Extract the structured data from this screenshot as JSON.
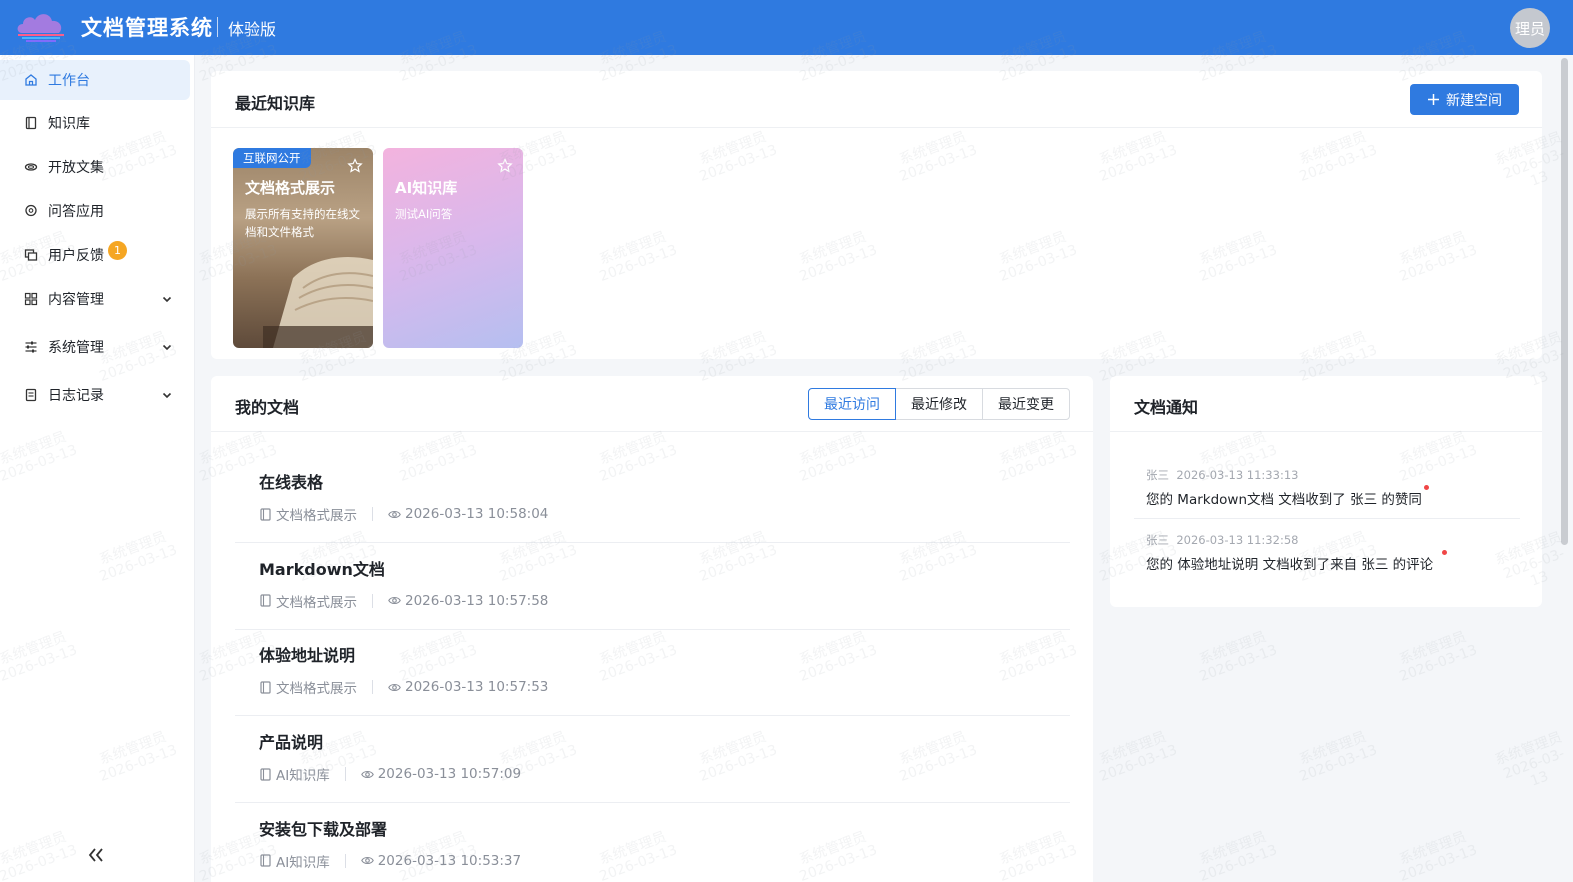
{
  "header": {
    "title": "文档管理系统",
    "edition": "体验版",
    "avatar_text": "理员"
  },
  "sidebar": {
    "items": [
      {
        "label": "工作台",
        "icon": "home-icon"
      },
      {
        "label": "知识库",
        "icon": "book-icon"
      },
      {
        "label": "开放文集",
        "icon": "share-icon"
      },
      {
        "label": "问答应用",
        "icon": "chat-icon"
      },
      {
        "label": "用户反馈",
        "icon": "feedback-icon",
        "badge": "1"
      },
      {
        "label": "内容管理",
        "icon": "grid-icon"
      },
      {
        "label": "系统管理",
        "icon": "sliders-icon"
      },
      {
        "label": "日志记录",
        "icon": "log-icon"
      }
    ]
  },
  "recent_kb": {
    "title": "最近知识库",
    "new_button": "新建空间",
    "cards": [
      {
        "tag": "互联网公开",
        "name": "文档格式展示",
        "desc": "展示所有支持的在线文档和文件格式"
      },
      {
        "name": "AI知识库",
        "desc": "测试AI问答"
      }
    ]
  },
  "my_docs": {
    "title": "我的文档",
    "tabs": [
      "最近访问",
      "最近修改",
      "最近变更"
    ],
    "active_tab": "最近访问",
    "items": [
      {
        "title": "在线表格",
        "kb": "文档格式展示",
        "time": "2026-03-13 10:58:04"
      },
      {
        "title": "Markdown文档",
        "kb": "文档格式展示",
        "time": "2026-03-13 10:57:58"
      },
      {
        "title": "体验地址说明",
        "kb": "文档格式展示",
        "time": "2026-03-13 10:57:53"
      },
      {
        "title": "产品说明",
        "kb": "AI知识库",
        "time": "2026-03-13 10:57:09"
      },
      {
        "title": "安装包下载及部署",
        "kb": "AI知识库",
        "time": "2026-03-13 10:53:37"
      }
    ]
  },
  "notifications": {
    "title": "文档通知",
    "items": [
      {
        "user": "张三",
        "time": "2026-03-13 11:33:13",
        "text": "您的 Markdown文档 文档收到了 张三 的赞同"
      },
      {
        "user": "张三",
        "time": "2026-03-13 11:32:58",
        "text": "您的 体验地址说明 文档收到了来自 张三 的评论"
      }
    ]
  },
  "watermark": {
    "line1": "系统管理员",
    "line2": "2026-03-13"
  },
  "colors": {
    "primary": "#2f7ae0",
    "badge": "#f5a623",
    "unread_dot": "#f04646"
  }
}
